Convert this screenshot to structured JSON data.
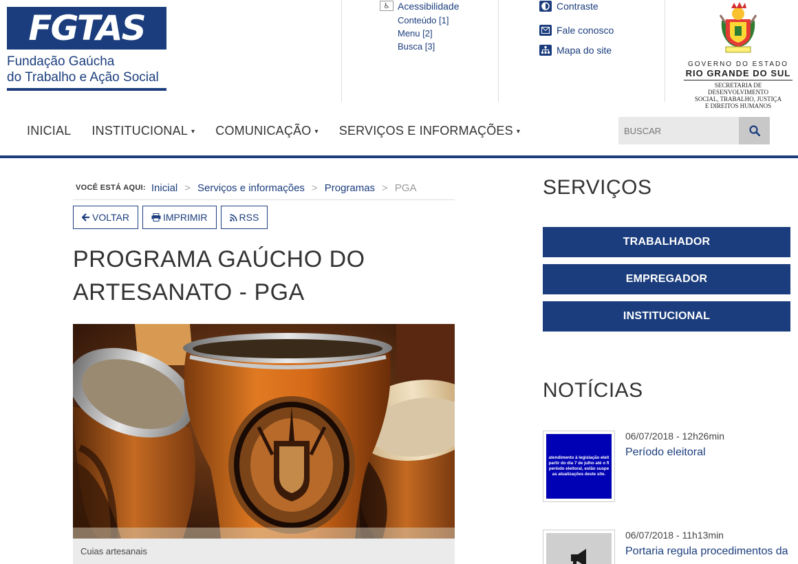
{
  "brand": {
    "logo_text": "FGTAS",
    "subtitle_line1": "Fundação Gaúcha",
    "subtitle_line2": "do Trabalho e Ação Social"
  },
  "accessibility": {
    "label": "Acessibilidade",
    "links": [
      "Conteúdo [1]",
      "Menu [2]",
      "Busca [3]"
    ]
  },
  "tools": {
    "contrast": "Contraste",
    "contact": "Fale conosco",
    "sitemap": "Mapa do site"
  },
  "government": {
    "line1": "GOVERNO DO ESTADO",
    "line2": "RIO GRANDE DO SUL",
    "line3": "SECRETARIA DE DESENVOLVIMENTO",
    "line4": "SOCIAL, TRABALHO, JUSTIÇA",
    "line5": "E DIREITOS HUMANOS"
  },
  "nav": {
    "items": [
      "INICIAL",
      "INSTITUCIONAL",
      "COMUNICAÇÃO",
      "SERVIÇOS E INFORMAÇÕES"
    ],
    "caret": "▾",
    "search_placeholder": "BUSCAR"
  },
  "breadcrumb": {
    "label": "VOCÊ ESTÁ AQUI:",
    "links": [
      "Inicial",
      "Serviços e informações",
      "Programas"
    ],
    "current": "PGA",
    "separator": ">"
  },
  "actions": {
    "back": "VOLTAR",
    "print": "IMPRIMIR",
    "rss": "RSS"
  },
  "page": {
    "title_line1": "PROGRAMA GAÚCHO DO",
    "title_line2": "ARTESANATO - PGA",
    "image_caption": "Cuias artesanais"
  },
  "sidebar": {
    "services_heading": "SERVIÇOS",
    "services": [
      "TRABALHADOR",
      "EMPREGADOR",
      "INSTITUCIONAL"
    ],
    "news_heading": "NOTÍCIAS",
    "news": [
      {
        "date": "06/07/2018 - 12h26min",
        "title": "Período eleitoral",
        "thumb_text": "atendimento à legislação eleit\npartir do dia 7 de julho até o fi\nperíodo eleitoral, estão suspe\nas atualizações deste site."
      },
      {
        "date": "06/07/2018 - 11h13min",
        "title": "Portaria regula procedimentos da"
      }
    ]
  },
  "colors": {
    "brand_blue": "#1b3d7d",
    "gov_blue_box": "#0000b4"
  }
}
